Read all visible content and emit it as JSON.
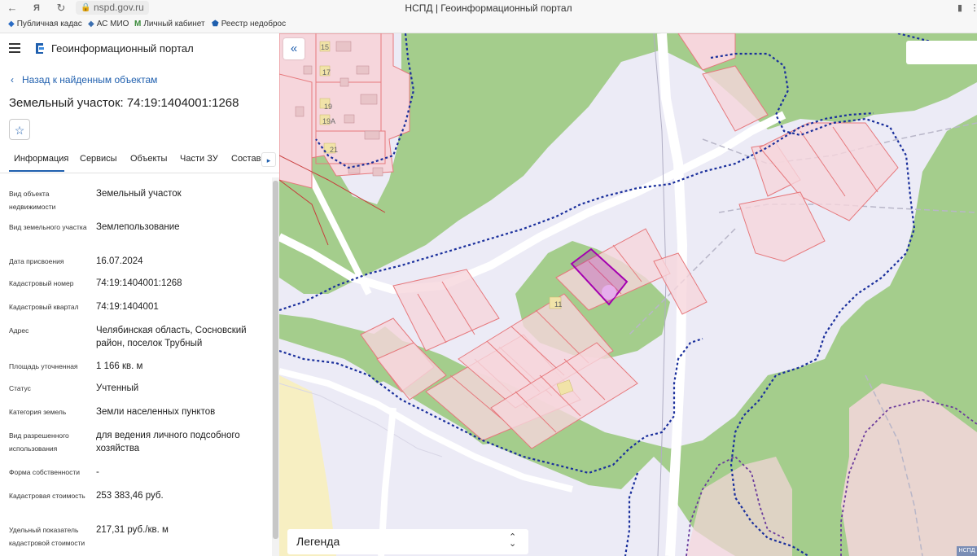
{
  "browser": {
    "url": "nspd.gov.ru",
    "title": "НСПД | Геоинформационный портал",
    "bookmarks": [
      "Публичная кадас",
      "АС МИО",
      "Личный кабинет",
      "Реестр недоброс"
    ]
  },
  "sidebar": {
    "portal_name": "Геоинформационный портал",
    "back_link": "Назад к найденным объектам",
    "object_title": "Земельный участок: 74:19:1404001:1268",
    "tabs": [
      "Информация",
      "Сервисы",
      "Объекты",
      "Части ЗУ",
      "Состав"
    ],
    "active_tab": "Информация",
    "fields": [
      {
        "label": "Вид объекта недвижимости",
        "value": "Земельный участок"
      },
      {
        "label": "Вид земельного участка",
        "value": "Землепользование"
      },
      {
        "label": "Дата присвоения",
        "value": "16.07.2024"
      },
      {
        "label": "Кадастровый номер",
        "value": "74:19:1404001:1268"
      },
      {
        "label": "Кадастровый квартал",
        "value": "74:19:1404001"
      },
      {
        "label": "Адрес",
        "value": "Челябинская область, Сосновский район, поселок Трубный"
      },
      {
        "label": "Площадь уточненная",
        "value": "1 166 кв. м"
      },
      {
        "label": "Статус",
        "value": "Учтенный"
      },
      {
        "label": "Категория земель",
        "value": "Земли населенных пунктов"
      },
      {
        "label": "Вид разрешенного использования",
        "value": "для ведения личного подсобного хозяйства"
      },
      {
        "label": "Форма собственности",
        "value": "-"
      },
      {
        "label": "Кадастровая стоимость",
        "value": "253 383,46 руб."
      },
      {
        "label": "Удельный показатель кадастровой стоимости",
        "value": "217,31 руб./кв. м"
      }
    ]
  },
  "map": {
    "house_numbers": [
      "15",
      "17",
      "19",
      "19А",
      "21",
      "11"
    ],
    "legend_label": "Легенда",
    "corner_label": "НСПД",
    "colors": {
      "forest": "#a4cd8c",
      "parcel_fill": "#f6d6dc",
      "parcel_stroke": "#e6787c",
      "selected": "#a400b0",
      "boundary": "#1a2f9c",
      "road": "#ffffff",
      "background": "#ecebf6",
      "sand": "#f7efc2"
    }
  }
}
